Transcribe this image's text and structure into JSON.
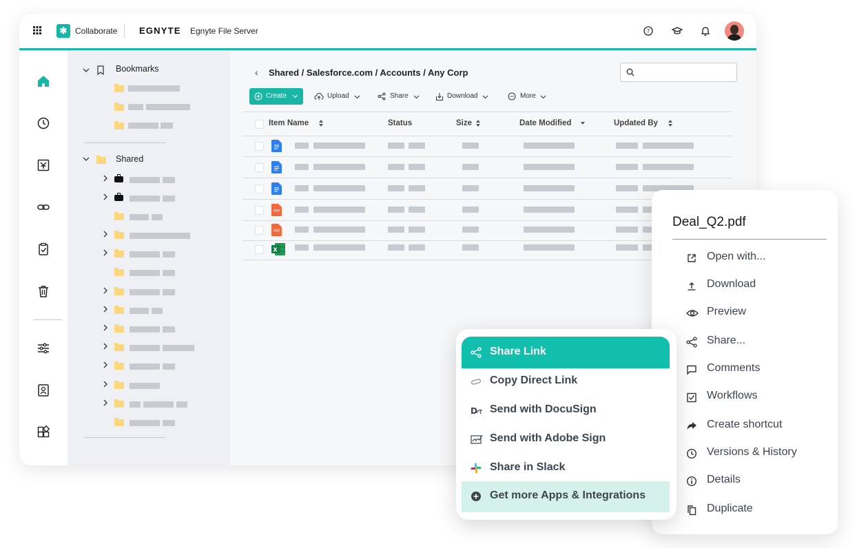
{
  "topbar": {
    "collaborate_label": "Collaborate",
    "brand": "EGNYTE",
    "product": "Egnyte File Server"
  },
  "tree": {
    "bookmarks_label": "Bookmarks",
    "shared_label": "Shared"
  },
  "main": {
    "breadcrumb": "Shared / Salesforce.com / Accounts / Any Corp",
    "search_placeholder": "",
    "toolbar": {
      "create": "Create",
      "upload": "Upload",
      "share": "Share",
      "download": "Download",
      "more": "More"
    },
    "columns": {
      "item_name": "Item Name",
      "status": "Status",
      "size": "Size",
      "date_modified": "Date Modified",
      "updated_by": "Updated By"
    },
    "rows": [
      {
        "type": "gdoc"
      },
      {
        "type": "gdoc"
      },
      {
        "type": "gdoc"
      },
      {
        "type": "pdf"
      },
      {
        "type": "pdf"
      },
      {
        "type": "xls"
      }
    ]
  },
  "context_menu": {
    "title": "Deal_Q2.pdf",
    "items": [
      {
        "label": "Open with...",
        "icon": "open-external-icon"
      },
      {
        "label": "Download",
        "icon": "download-icon"
      },
      {
        "label": "Preview",
        "icon": "eye-icon"
      },
      {
        "label": "Share...",
        "icon": "share-icon"
      },
      {
        "label": "Comments",
        "icon": "comment-icon"
      },
      {
        "label": "Workflows",
        "icon": "checkbox-icon"
      },
      {
        "label": "Create shortcut",
        "icon": "shortcut-arrow-icon"
      },
      {
        "label": "Versions & History",
        "icon": "clock-icon"
      },
      {
        "label": "Details",
        "icon": "info-icon"
      },
      {
        "label": "Duplicate",
        "icon": "duplicate-icon"
      }
    ]
  },
  "share_menu": {
    "items": [
      {
        "label": "Share Link",
        "icon": "share-icon"
      },
      {
        "label": "Copy Direct Link",
        "icon": "link-icon"
      },
      {
        "label": "Send with DocuSign",
        "icon": "docusign-icon"
      },
      {
        "label": "Send with Adobe Sign",
        "icon": "adobe-sign-icon"
      },
      {
        "label": "Share in Slack",
        "icon": "slack-icon"
      },
      {
        "label": "Get more Apps & Integrations",
        "icon": "plus-circle-icon"
      }
    ]
  },
  "colors": {
    "accent": "#19b6a6",
    "share_active": "#11bfac",
    "share_light": "#d4f1ec",
    "folder": "#fdd77e"
  }
}
